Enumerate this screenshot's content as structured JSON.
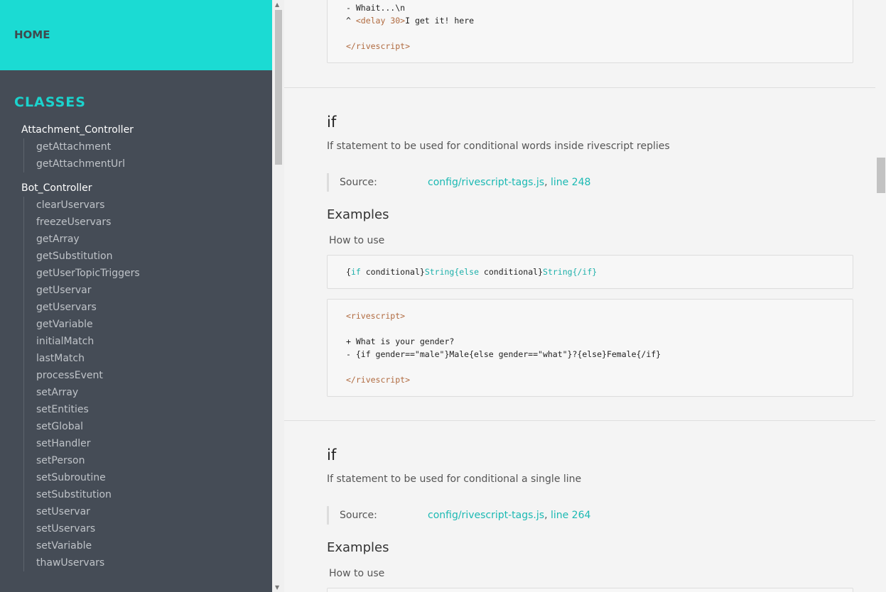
{
  "sidebar": {
    "home": "HOME",
    "classes_title": "CLASSES",
    "classes": [
      {
        "name": "Attachment_Controller",
        "methods": [
          "getAttachment",
          "getAttachmentUrl"
        ]
      },
      {
        "name": "Bot_Controller",
        "methods": [
          "clearUservars",
          "freezeUservars",
          "getArray",
          "getSubstitution",
          "getUserTopicTriggers",
          "getUservar",
          "getUservars",
          "getVariable",
          "initialMatch",
          "lastMatch",
          "processEvent",
          "setArray",
          "setEntities",
          "setGlobal",
          "setHandler",
          "setPerson",
          "setSubroutine",
          "setSubstitution",
          "setUservar",
          "setUservars",
          "setVariable",
          "thawUservars"
        ]
      }
    ]
  },
  "top_code": {
    "line1": "- Whait...\\n",
    "line2_pre": "^ ",
    "line2_tag": "<delay 30>",
    "line2_text": "I get it! here",
    "close": "</rivescript>"
  },
  "sections": [
    {
      "title": "if",
      "description": "If statement to be used for conditional words inside rivescript replies",
      "source_label": "Source:",
      "source_file": "config/rivescript-tags.js",
      "source_sep": ", ",
      "source_line": "line 248",
      "examples_title": "Examples",
      "how_to": "How to use",
      "usage": {
        "a": "{",
        "b": "if",
        "c": " conditional}",
        "d": "String",
        "e": "{",
        "f": "else",
        "g": " conditional}",
        "h": "String",
        "i": "{/if}"
      },
      "example": {
        "open": "<rivescript>",
        "l1": "+ What is your gender?",
        "l2": "- {if gender==\"male\"}Male{else gender==\"what\"}?{else}Female{/if}",
        "close": "</rivescript>"
      }
    },
    {
      "title": "if",
      "description": "If statement to be used for conditional a single line",
      "source_label": "Source:",
      "source_file": "config/rivescript-tags.js",
      "source_sep": ", ",
      "source_line": "line 264",
      "examples_title": "Examples",
      "how_to": "How to use"
    }
  ]
}
